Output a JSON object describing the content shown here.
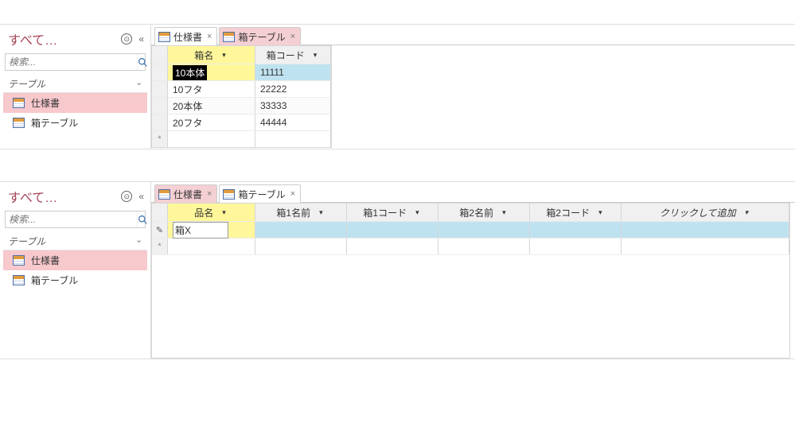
{
  "top": {
    "nav": {
      "title": "すべて…",
      "circle_glyph": "⊙",
      "collapse_glyph": "«",
      "search_placeholder": "検索...",
      "group_label": "テーブル",
      "group_chevron": "⌄",
      "items": [
        {
          "label": "仕様書",
          "selected": true
        },
        {
          "label": "箱テーブル",
          "selected": false
        }
      ]
    },
    "tabs": [
      {
        "label": "仕様書",
        "active": false
      },
      {
        "label": "箱テーブル",
        "active": true
      }
    ],
    "grid": {
      "columns": [
        {
          "label": "箱名",
          "highlighted": true
        },
        {
          "label": "箱コード",
          "highlighted": false
        }
      ],
      "rows": [
        {
          "col0": "10本体",
          "col1": "11111",
          "editing": true,
          "selected": true
        },
        {
          "col0": "10フタ",
          "col1": "22222"
        },
        {
          "col0": "20本体",
          "col1": "33333"
        },
        {
          "col0": "20フタ",
          "col1": "44444"
        }
      ],
      "new_row_glyph": "*"
    }
  },
  "bottom": {
    "nav": {
      "title": "すべて…",
      "circle_glyph": "⊙",
      "collapse_glyph": "«",
      "search_placeholder": "検索...",
      "group_label": "テーブル",
      "group_chevron": "⌄",
      "items": [
        {
          "label": "仕様書",
          "selected": true
        },
        {
          "label": "箱テーブル",
          "selected": false
        }
      ]
    },
    "tabs": [
      {
        "label": "仕様書",
        "active": true
      },
      {
        "label": "箱テーブル",
        "active": false
      }
    ],
    "grid": {
      "columns": [
        {
          "label": "品名",
          "highlighted": true
        },
        {
          "label": "箱1名前"
        },
        {
          "label": "箱1コード"
        },
        {
          "label": "箱2名前"
        },
        {
          "label": "箱2コード"
        },
        {
          "label": "クリックして追加",
          "add": true
        }
      ],
      "edit_row": {
        "col0": "箱X"
      },
      "edit_glyph": "✎",
      "new_row_glyph": "*"
    }
  }
}
